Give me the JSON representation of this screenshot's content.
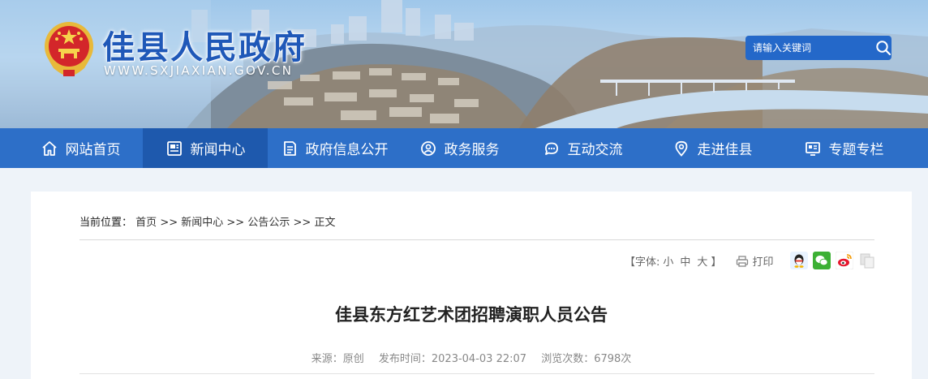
{
  "header": {
    "site_title": "佳县人民政府",
    "site_url": "WWW.SXJIAXIAN.GOV.CN",
    "search_placeholder": "请输入关键词"
  },
  "nav": {
    "items": [
      {
        "label": "网站首页",
        "icon": "home-icon"
      },
      {
        "label": "新闻中心",
        "icon": "news-icon",
        "active": true
      },
      {
        "label": "政府信息公开",
        "icon": "document-icon"
      },
      {
        "label": "政务服务",
        "icon": "service-icon"
      },
      {
        "label": "互动交流",
        "icon": "chat-icon"
      },
      {
        "label": "走进佳县",
        "icon": "location-icon"
      },
      {
        "label": "专题专栏",
        "icon": "column-icon"
      }
    ]
  },
  "breadcrumb": {
    "label": "当前位置：",
    "items": [
      "首页",
      "新闻中心",
      "公告公示",
      "正文"
    ],
    "separator": ">>"
  },
  "tools": {
    "font_open": "【字体:",
    "font_small": "小",
    "font_medium": "中",
    "font_large": "大",
    "font_close": "】",
    "print_label": "打印"
  },
  "share": [
    "qq-icon",
    "wechat-icon",
    "weibo-icon",
    "copy-icon"
  ],
  "article": {
    "title": "佳县东方红艺术团招聘演职人员公告",
    "source_label": "来源：",
    "source": "原创",
    "date_label": "发布时间：",
    "date": "2023-04-03 22:07",
    "views_label": "浏览次数：",
    "views": "6798次"
  },
  "colors": {
    "nav_bg": "#2d6fc8",
    "nav_active": "#1e59ad",
    "title_blue": "#1f58b8",
    "page_bg": "#eef3f9"
  }
}
